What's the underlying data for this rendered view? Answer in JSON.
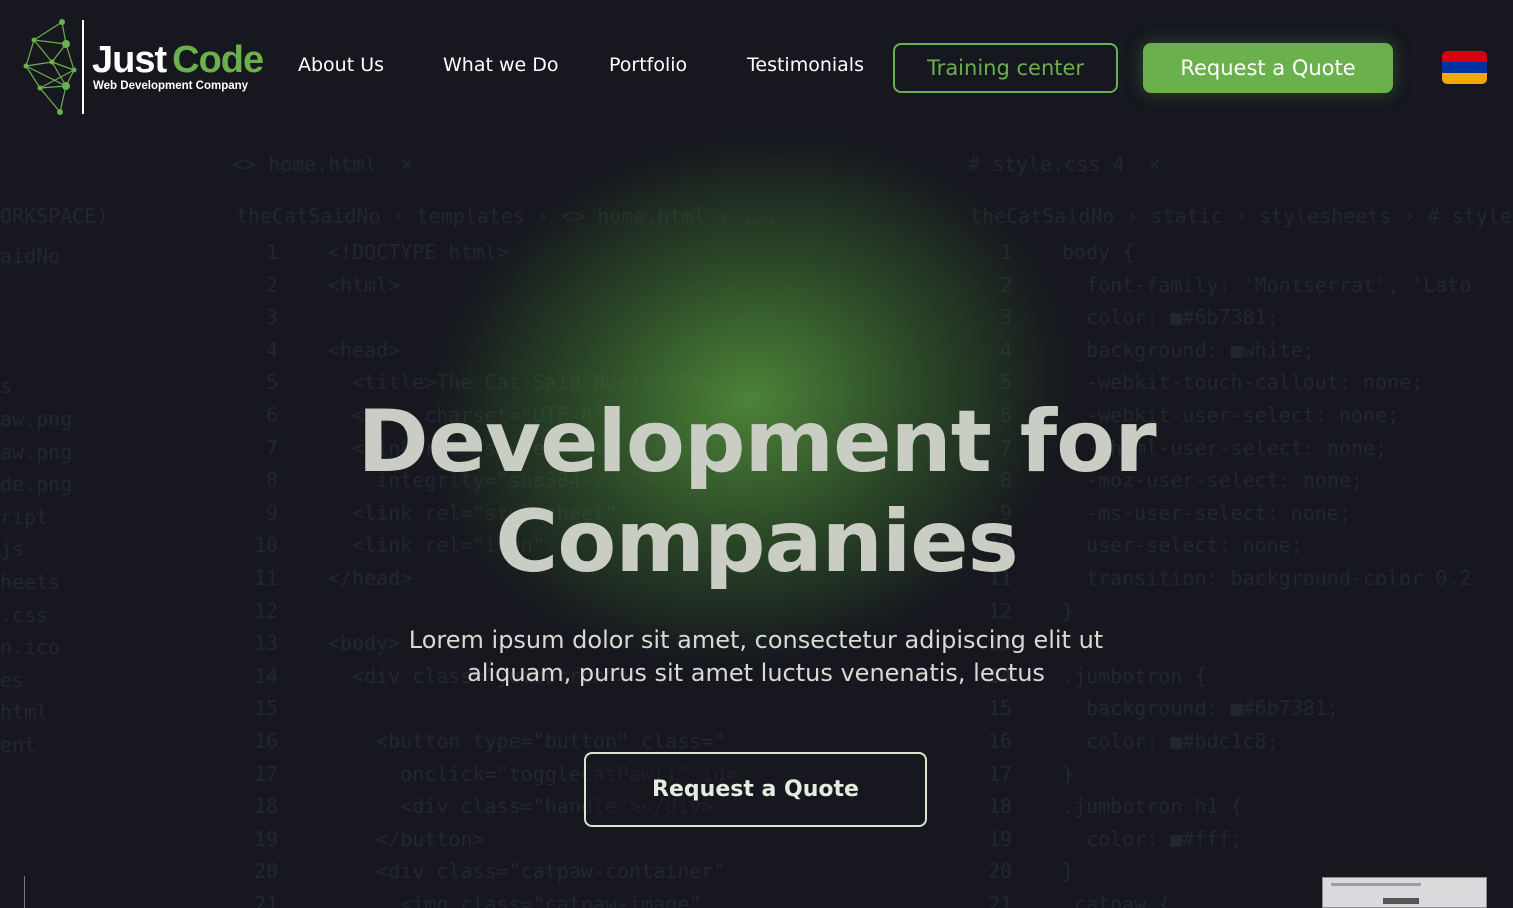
{
  "brand": {
    "name_part1": "Just",
    "name_part2": "Code",
    "tagline": "Web Development Company"
  },
  "nav": {
    "items": [
      "About Us",
      "What we Do",
      "Portfolio",
      "Testimonials"
    ],
    "training_label": "Training center",
    "quote_label": "Request a Quote",
    "language_flag": "armenia-flag-icon"
  },
  "hero": {
    "title_line1": "Development for",
    "title_line2": "Companies",
    "subtitle_line1": "Lorem ipsum dolor sit amet, consectetur adipiscing elit ut",
    "subtitle_line2": "aliquam, purus sit amet luctus venenatis, lectus",
    "cta_label": "Request a Quote"
  },
  "colors": {
    "background": "#16171f",
    "accent_green": "#6ab04c",
    "flag_red": "#d90012",
    "flag_blue": "#0033a0",
    "flag_orange": "#f2a800"
  }
}
